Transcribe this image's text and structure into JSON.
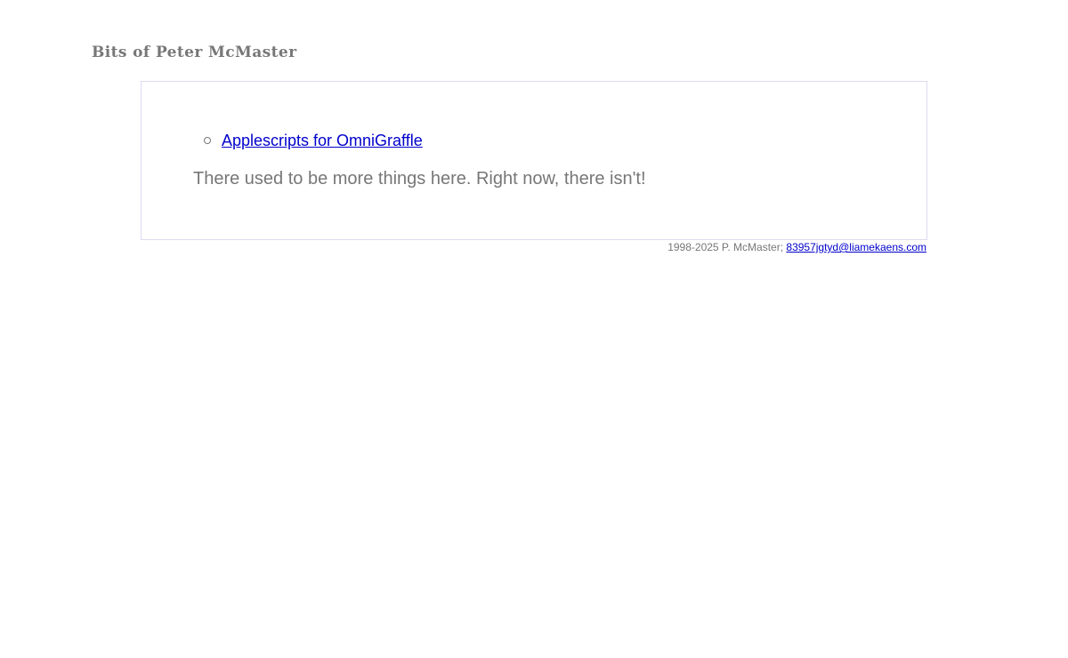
{
  "header": {
    "title": "Bits of Peter McMaster"
  },
  "main": {
    "links": [
      {
        "label": "Applescripts for OmniGraffle"
      }
    ],
    "message": "There used to be more things here. Right now, there isn't!"
  },
  "footer": {
    "copyright": "1998-2025 P. McMaster;",
    "email": "83957jgtyd@liamekaens.com"
  },
  "colors": {
    "text": "#777777",
    "link": "#0000cc",
    "box_border": "#dcdcf0",
    "background": "#ffffff"
  },
  "icons": {
    "list_bullet": "hollow-circle-bullet-icon"
  }
}
